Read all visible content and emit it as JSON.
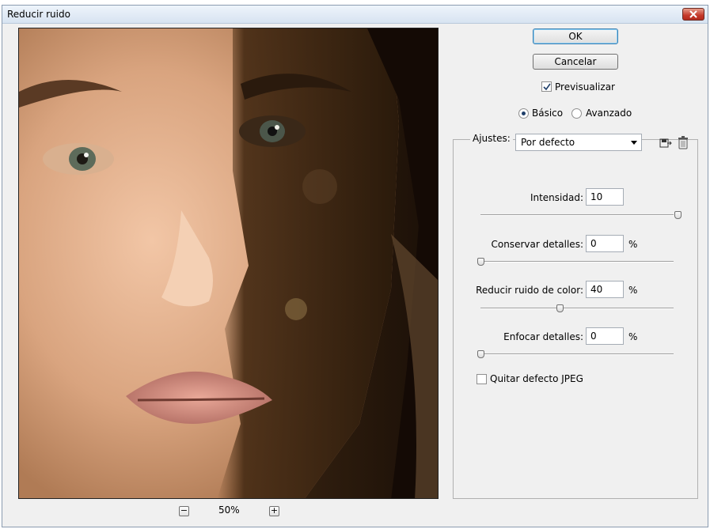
{
  "window": {
    "title": "Reducir ruido"
  },
  "buttons": {
    "ok": "OK",
    "cancel": "Cancelar"
  },
  "preview_toggle": {
    "label": "Previsualizar",
    "checked": true
  },
  "mode": {
    "basic": "Básico",
    "advanced": "Avanzado",
    "selected": "basic"
  },
  "settings": {
    "label": "Ajustes:",
    "value": "Por defecto",
    "icons": [
      "save-settings-icon",
      "delete-settings-icon"
    ]
  },
  "params": {
    "intensity": {
      "label": "Intensidad:",
      "value": "10",
      "unit": "",
      "slider": 1.0
    },
    "preserve": {
      "label": "Conservar detalles:",
      "value": "0",
      "unit": "%",
      "slider": 0.0
    },
    "color_noise": {
      "label": "Reducir ruido de color:",
      "value": "40",
      "unit": "%",
      "slider": 0.4
    },
    "sharpen": {
      "label": "Enfocar detalles:",
      "value": "0",
      "unit": "%",
      "slider": 0.0
    }
  },
  "jpeg": {
    "label": "Quitar defecto JPEG",
    "checked": false
  },
  "zoom": {
    "minus": "−",
    "plus": "+",
    "value": "50%"
  },
  "colors": {
    "accent": "#3c7fb1",
    "panel": "#f0f0f0",
    "close": "#c4392a"
  }
}
